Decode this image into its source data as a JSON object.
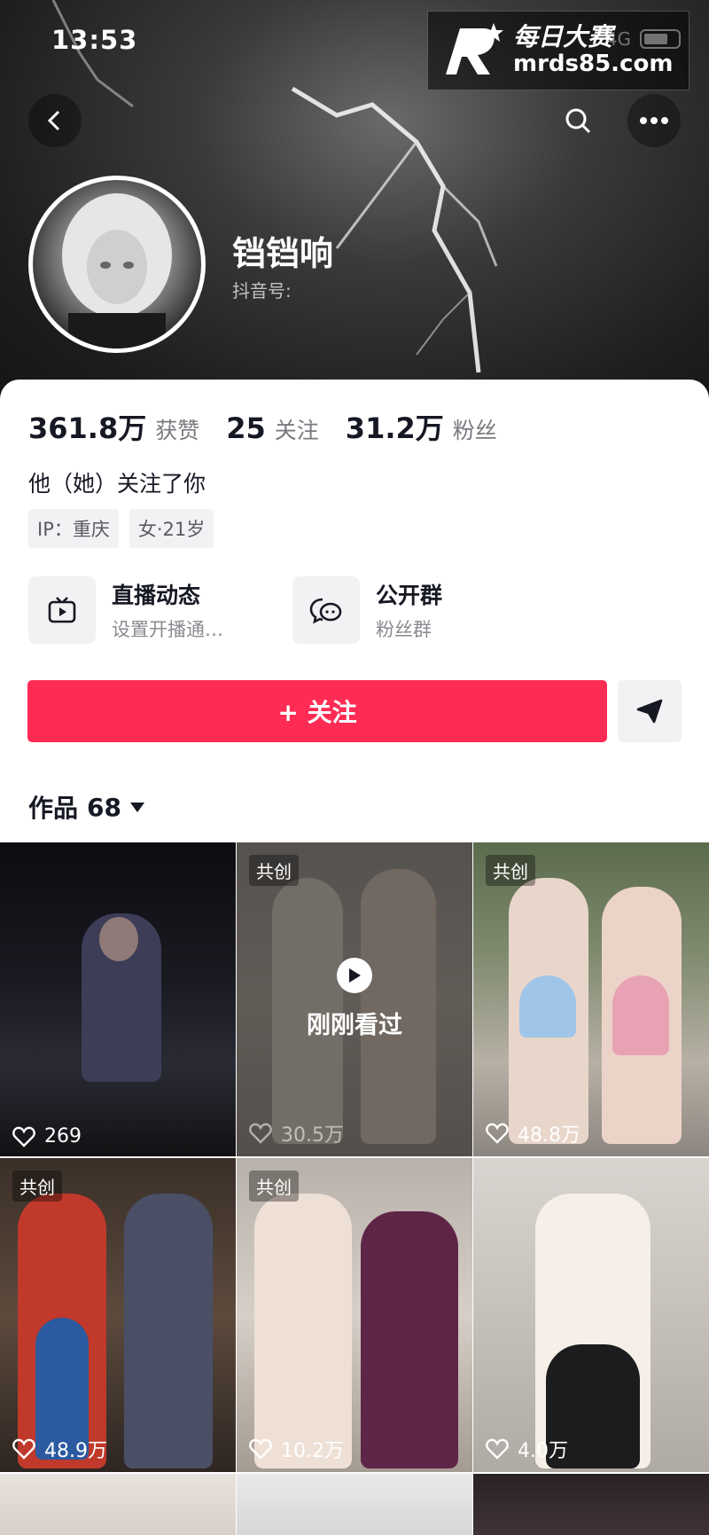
{
  "status_bar": {
    "time": "13:53",
    "network": "4G"
  },
  "watermark": {
    "title": "每日大赛",
    "url": "mrds85.com"
  },
  "header": {
    "back_icon": "chevron-left-icon",
    "search_icon": "search-icon",
    "more_icon": "more-dots-icon"
  },
  "profile": {
    "nickname": "铛铛响",
    "douyin_id_label": "抖音号:",
    "stats": [
      {
        "value": "361.8万",
        "label": "获赞"
      },
      {
        "value": "25",
        "label": "关注"
      },
      {
        "value": "31.2万",
        "label": "粉丝"
      }
    ],
    "follow_note": "他（她）关注了你",
    "tags": [
      "IP：重庆",
      "女·21岁"
    ]
  },
  "shortcuts": [
    {
      "icon": "tv-icon",
      "title": "直播动态",
      "subtitle": "设置开播通…"
    },
    {
      "icon": "group-chat-icon",
      "title": "公开群",
      "subtitle": "粉丝群"
    }
  ],
  "actions": {
    "follow_label": "+ 关注",
    "share_icon": "send-icon"
  },
  "works": {
    "label": "作品",
    "count": "68"
  },
  "grid": [
    {
      "badge": "",
      "likes": "269",
      "seen": ""
    },
    {
      "badge": "共创",
      "likes": "30.5万",
      "seen": "刚刚看过"
    },
    {
      "badge": "共创",
      "likes": "48.8万",
      "seen": ""
    },
    {
      "badge": "共创",
      "likes": "48.9万",
      "seen": ""
    },
    {
      "badge": "共创",
      "likes": "10.2万",
      "seen": ""
    },
    {
      "badge": "",
      "likes": "4.0万",
      "seen": ""
    }
  ]
}
